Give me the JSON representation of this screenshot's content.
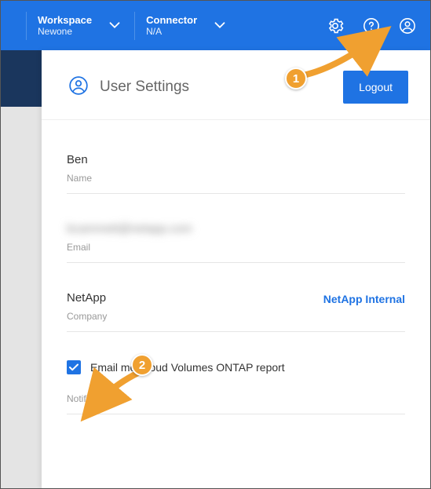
{
  "topbar": {
    "workspace": {
      "label": "Workspace",
      "value": "Newone"
    },
    "connector": {
      "label": "Connector",
      "value": "N/A"
    }
  },
  "panel": {
    "title": "User Settings",
    "logout": "Logout"
  },
  "profile": {
    "name": {
      "value": "Ben",
      "label": "Name"
    },
    "email": {
      "value": "bcammett@netapp.com",
      "label": "Email"
    },
    "company": {
      "value": "NetApp",
      "label": "Company",
      "link": "NetApp Internal"
    },
    "notification": {
      "checkbox_label": "Email me Cloud Volumes ONTAP report",
      "label": "Notification",
      "checked": true
    }
  },
  "callouts": {
    "one": "1",
    "two": "2"
  }
}
